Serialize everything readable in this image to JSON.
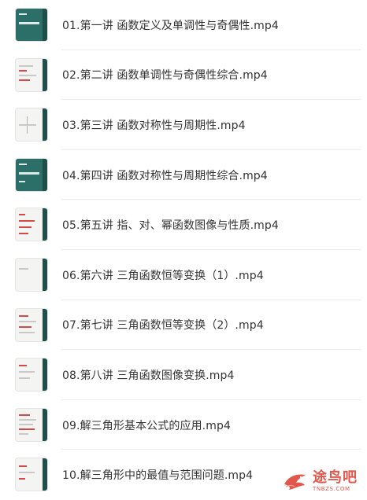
{
  "files": [
    {
      "name": "01.第一讲 函数定义及单调性与奇偶性.mp4",
      "thumb_style": "teal"
    },
    {
      "name": "02.第二讲 函数单调性与奇偶性综合.mp4",
      "thumb_style": "light"
    },
    {
      "name": "03.第三讲 函数对称性与周期性.mp4",
      "thumb_style": "light"
    },
    {
      "name": "04.第四讲 函数对称性与周期性综合.mp4",
      "thumb_style": "teal"
    },
    {
      "name": "05.第五讲 指、对、幂函数图像与性质.mp4",
      "thumb_style": "light"
    },
    {
      "name": "06.第六讲 三角函数恒等变换（1）.mp4",
      "thumb_style": "light"
    },
    {
      "name": "07.第七讲 三角函数恒等变换（2）.mp4",
      "thumb_style": "light"
    },
    {
      "name": "08.第八讲 三角函数图像变换.mp4",
      "thumb_style": "light"
    },
    {
      "name": "09.解三角形基本公式的应用.mp4",
      "thumb_style": "light"
    },
    {
      "name": "10.解三角形中的最值与范围问题.mp4",
      "thumb_style": "light"
    }
  ],
  "watermark": {
    "name": "途鸟吧",
    "url": "TNBZS.COM",
    "color": "#e2574c",
    "icon": "bird-logo-icon"
  },
  "colors": {
    "text": "#333333",
    "thumb_teal": "#2c6e68",
    "divider": "#ececec"
  }
}
